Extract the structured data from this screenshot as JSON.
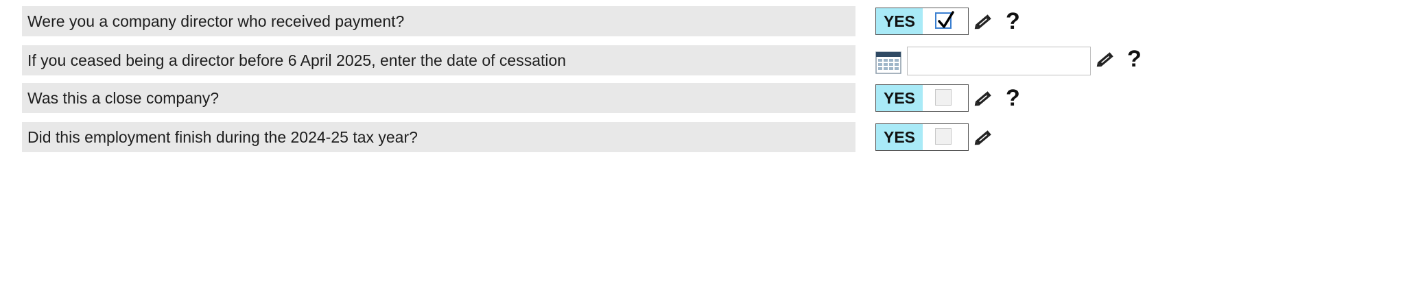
{
  "questions": [
    {
      "text": "Were you a company director who received payment?",
      "type": "yesno",
      "yes_label": "YES",
      "checked": true,
      "help": "?"
    },
    {
      "text": "If you ceased being a director before 6 April 2025, enter the date of cessation",
      "type": "date",
      "value": "",
      "help": "?"
    },
    {
      "text": "Was this a close company?",
      "type": "yesno",
      "yes_label": "YES",
      "checked": false,
      "help": "?"
    },
    {
      "text": "Did this employment finish during the 2024-25 tax year?",
      "type": "yesno",
      "yes_label": "YES",
      "checked": false
    }
  ],
  "icons": {
    "edit": "pencil-icon",
    "calendar": "calendar-icon",
    "check": "checkmark-icon"
  },
  "colors": {
    "question_bg": "#e8e8e8",
    "yes_bg": "#a9eaf7",
    "checkbox_focus": "#3a7fd0"
  }
}
